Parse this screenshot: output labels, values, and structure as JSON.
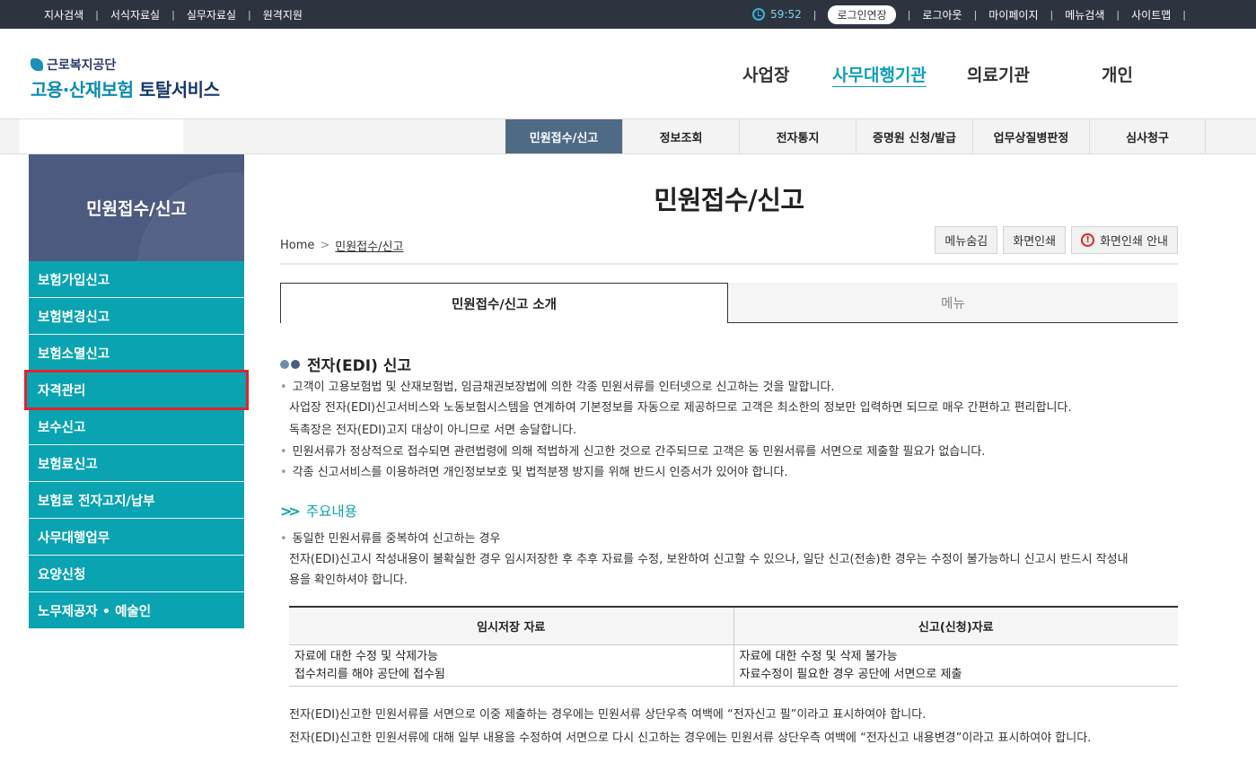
{
  "topbar": {
    "left_links": [
      "지사검색",
      "서식자료실",
      "실무자료실",
      "원격지원"
    ],
    "timer": "59:52",
    "extend_label": "로그인연장",
    "right_links": [
      "로그아웃",
      "마이페이지",
      "메뉴검색",
      "사이트맵"
    ]
  },
  "logo": {
    "sub": "근로복지공단",
    "main_hl": "고용·산재보험",
    "main_rest": " 토탈서비스"
  },
  "gnb": [
    "사업장",
    "사무대행기관",
    "의료기관",
    "개인"
  ],
  "subnav": [
    "민원접수/신고",
    "정보조회",
    "전자통지",
    "증명원 신청/발급",
    "업무상질병판정",
    "심사청구"
  ],
  "lnb": {
    "title": "민원접수/신고",
    "items": [
      "보험가입신고",
      "보험변경신고",
      "보험소멸신고",
      "자격관리",
      "보수신고",
      "보험료신고",
      "보험료 전자고지/납부",
      "사무대행업무",
      "요양신청",
      "노무제공자 • 예술인"
    ]
  },
  "page": {
    "title": "민원접수/신고",
    "breadcrumb_home": "Home",
    "breadcrumb_current": "민원접수/신고",
    "tools": {
      "hide_menu": "메뉴숨김",
      "print": "화면인쇄",
      "print_guide": "화면인쇄 안내"
    },
    "tabs": [
      "민원접수/신고 소개",
      "메뉴"
    ]
  },
  "section1": {
    "title": "전자(EDI) 신고",
    "lines": [
      "고객이 고용보험법 및 산재보험법, 임금채권보장법에 의한 각종 민원서류를 인터넷으로 신고하는 것을 말합니다.",
      "사업장 전자(EDI)신고서비스와 노동보험시스템을 연계하여 기본정보를 자동으로 제공하므로 고객은 최소한의 정보만 입력하면 되므로 매우 간편하고 편리합니다.",
      "독촉장은 전자(EDI)고지 대상이 아니므로 서면 송달합니다.",
      "민원서류가 정상적으로 접수되면 관련법령에 의해 적법하게 신고한 것으로 간주되므로 고객은 동 민원서류를 서면으로 제출할 필요가 없습니다.",
      "각종 신고서비스를 이용하려면 개인정보보호 및 법적분쟁 방지를 위해 반드시 인증서가 있어야 합니다."
    ]
  },
  "section2": {
    "title": "주요내용",
    "bullet": "동일한 민원서류를 중복하여 신고하는 경우",
    "para1": "전자(EDI)신고시 작성내용이 불확실한 경우 임시저장한 후 추후 자료를 수정, 보완하여 신고할 수 있으나, 일단 신고(전송)한 경우는 수정이 불가능하니 신고시 반드시 작성내",
    "para2": "용을 확인하셔야 합니다.",
    "table": {
      "headers": [
        "임시저장 자료",
        "신고(신청)자료"
      ],
      "col1": [
        "자료에 대한 수정 및 삭제가능",
        "접수처리를 해야 공단에 접수됨"
      ],
      "col2": [
        "자료에 대한 수정 및 삭제 불가능",
        "자료수정이 필요한 경우 공단에 서면으로 제출"
      ]
    },
    "note1": "전자(EDI)신고한 민원서류를 서면으로 이중 제출하는 경우에는 민원서류 상단우측 여백에 “전자신고 필”이라고 표시하여야 합니다.",
    "note2": "전자(EDI)신고한 민원서류에 대해 일부 내용을 수정하여 서면으로 다시 신고하는 경우에는 민원서류 상단우측 여백에 “전자신고 내용변경”이라고 표시하여야 합니다."
  }
}
